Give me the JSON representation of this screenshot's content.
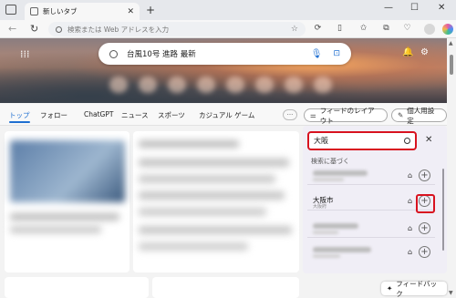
{
  "browser": {
    "tab_title": "新しいタブ",
    "tab_close": "✕",
    "new_tab": "+",
    "address_placeholder": "検索または Web アドレスを入力",
    "window_controls": [
      "—",
      "☐",
      "✕"
    ]
  },
  "hero": {
    "search_query": "台風10号 進路 最新"
  },
  "feed_nav": {
    "items": [
      "トップ",
      "フォロー",
      "ChatGPT",
      "ニュース",
      "スポーツ",
      "カジュアル ゲーム"
    ],
    "more": "···",
    "layout_button": "フィードのレイアウト",
    "personalize_button": "個人用設定"
  },
  "search_panel": {
    "input_value": "大阪",
    "section_label": "検索に基づく",
    "results": [
      {
        "name": "",
        "sub": ""
      },
      {
        "name": "大阪市",
        "sub": "大阪府"
      },
      {
        "name": "",
        "sub": ""
      },
      {
        "name": "",
        "sub": ""
      }
    ],
    "add_symbol": "+",
    "close_symbol": "✕"
  },
  "footer": {
    "feedback_label": "フィードバック"
  },
  "colors": {
    "accent": "#1f6fd1",
    "highlight": "#d8121f",
    "panel_bg": "#f0eef6"
  }
}
